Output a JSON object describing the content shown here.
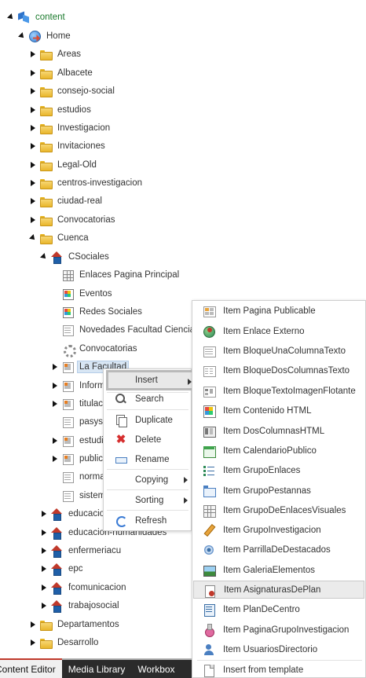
{
  "tree": {
    "nodes": [
      {
        "label": "content",
        "icon": "content-cube-icon"
      },
      {
        "label": "Home",
        "icon": "home-globe-icon"
      },
      {
        "label": "Areas",
        "icon": "folder-icon"
      },
      {
        "label": "Albacete",
        "icon": "folder-icon"
      },
      {
        "label": "consejo-social",
        "icon": "folder-icon"
      },
      {
        "label": "estudios",
        "icon": "folder-icon"
      },
      {
        "label": "Investigacion",
        "icon": "folder-icon"
      },
      {
        "label": "Invitaciones",
        "icon": "folder-icon"
      },
      {
        "label": "Legal-Old",
        "icon": "folder-icon"
      },
      {
        "label": "centros-investigacion",
        "icon": "folder-icon"
      },
      {
        "label": "ciudad-real",
        "icon": "folder-icon"
      },
      {
        "label": "Convocatorias",
        "icon": "folder-icon"
      },
      {
        "label": "Cuenca",
        "icon": "folder-icon"
      },
      {
        "label": "CSociales",
        "icon": "house-icon"
      },
      {
        "label": "Enlaces Pagina Principal",
        "icon": "grid-icon"
      },
      {
        "label": "Eventos",
        "icon": "widget-icon"
      },
      {
        "label": "Redes Sociales",
        "icon": "widget-icon"
      },
      {
        "label": "Novedades Facultad Ciencias",
        "icon": "page-icon"
      },
      {
        "label": "Convocatorias",
        "icon": "gear-icon"
      },
      {
        "label": "La Facultad",
        "icon": "page-color-icon"
      },
      {
        "label": "Inform",
        "icon": "page-color-icon"
      },
      {
        "label": "titulac",
        "icon": "page-color-icon"
      },
      {
        "label": "pasyse",
        "icon": "page-icon"
      },
      {
        "label": "estudi",
        "icon": "page-color-icon"
      },
      {
        "label": "public",
        "icon": "page-color-icon"
      },
      {
        "label": "norma",
        "icon": "page-icon"
      },
      {
        "label": "sistem",
        "icon": "page-icon"
      },
      {
        "label": "educacion",
        "icon": "house-icon"
      },
      {
        "label": "educacion-humanidades",
        "icon": "house-icon"
      },
      {
        "label": "enfermeriacu",
        "icon": "house-icon"
      },
      {
        "label": "epc",
        "icon": "house-icon"
      },
      {
        "label": "fcomunicacion",
        "icon": "house-icon"
      },
      {
        "label": "trabajosocial",
        "icon": "house-icon"
      },
      {
        "label": "Departamentos",
        "icon": "folder-icon"
      },
      {
        "label": "Desarrollo",
        "icon": "folder-icon"
      }
    ]
  },
  "context_menu": {
    "items": [
      {
        "label": "Insert",
        "icon": "",
        "submenu": true
      },
      {
        "label": "Search",
        "icon": "search-icon"
      },
      {
        "label": "Duplicate",
        "icon": "duplicate-icon"
      },
      {
        "label": "Delete",
        "icon": "delete-icon"
      },
      {
        "label": "Rename",
        "icon": "rename-icon"
      },
      {
        "label": "Copying",
        "icon": "",
        "submenu": true
      },
      {
        "label": "Sorting",
        "icon": "",
        "submenu": true
      },
      {
        "label": "Refresh",
        "icon": "refresh-icon"
      }
    ]
  },
  "insert_menu": {
    "items": [
      {
        "label": "Item Pagina Publicable",
        "icon": "page-publishable-icon"
      },
      {
        "label": "Item Enlace Externo",
        "icon": "external-link-globe-icon"
      },
      {
        "label": "Item BloqueUnaColumnaTexto",
        "icon": "single-column-text-icon"
      },
      {
        "label": "Item BloqueDosColumnasTexto",
        "icon": "two-column-text-icon"
      },
      {
        "label": "Item BloqueTextoImagenFlotante",
        "icon": "floating-image-text-icon"
      },
      {
        "label": "Item Contenido HTML",
        "icon": "html-content-icon"
      },
      {
        "label": "Item DosColumnasHTML",
        "icon": "two-column-html-icon"
      },
      {
        "label": "Item CalendarioPublico",
        "icon": "calendar-icon"
      },
      {
        "label": "Item GrupoEnlaces",
        "icon": "link-list-icon"
      },
      {
        "label": "Item GrupoPestannas",
        "icon": "tabs-icon"
      },
      {
        "label": "Item GrupoDeEnlacesVisuales",
        "icon": "visual-links-grid-icon"
      },
      {
        "label": "Item GrupoInvestigacion",
        "icon": "pencil-icon"
      },
      {
        "label": "Item ParrillaDeDestacados",
        "icon": "target-icon"
      },
      {
        "label": "Item GaleriaElementos",
        "icon": "gallery-icon"
      },
      {
        "label": "Item AsignaturasDePlan",
        "icon": "subjects-plan-icon"
      },
      {
        "label": "Item PlanDeCentro",
        "icon": "center-plan-icon"
      },
      {
        "label": "Item PaginaGrupoInvestigacion",
        "icon": "flask-icon"
      },
      {
        "label": "Item UsuariosDirectorio",
        "icon": "users-directory-icon"
      },
      {
        "label": "Insert from template",
        "icon": "template-icon"
      }
    ]
  },
  "tabs": [
    {
      "label": "Content Editor"
    },
    {
      "label": "Media Library"
    },
    {
      "label": "Workbox"
    }
  ]
}
